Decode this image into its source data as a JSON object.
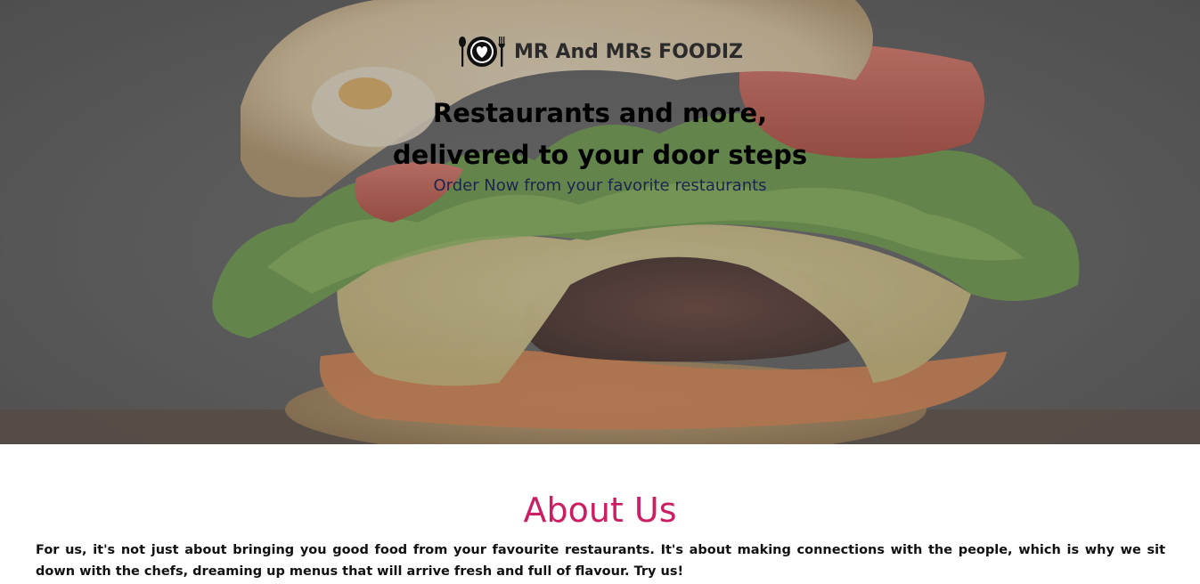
{
  "brand": {
    "name": "MR And MRs FOODIZ",
    "icon": "plate-heart-cutlery-icon"
  },
  "hero": {
    "headline_line1": "Restaurants and more,",
    "headline_line2": "delivered to your door steps",
    "tagline": "Order Now from your favorite restaurants",
    "background": "burger-photo"
  },
  "about": {
    "title": "About Us",
    "text": "For us, it's not just about bringing you good food from your favourite restaurants. It's about making connections with the people, which is why we sit down with the chefs, dreaming up menus that will arrive fresh and full of flavour. Try us!"
  },
  "colors": {
    "accent": "#cc1e63",
    "tagline": "#1e2450"
  }
}
